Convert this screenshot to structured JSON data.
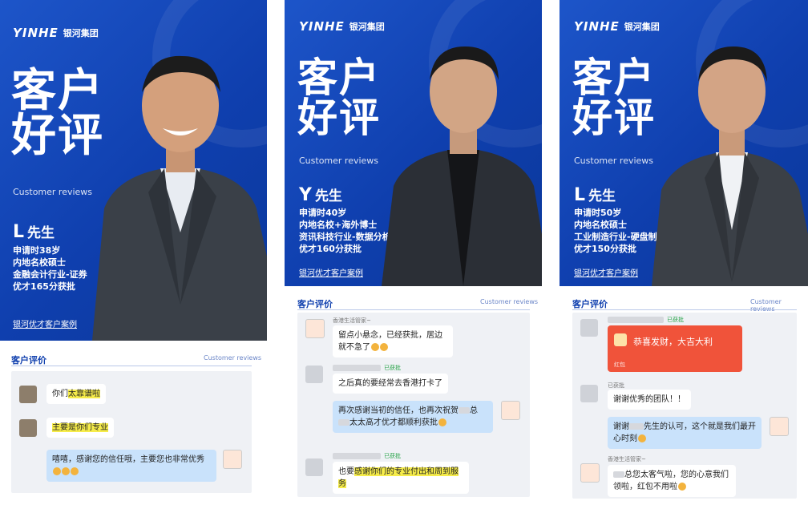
{
  "brand": {
    "mark": "YINHE",
    "name": "银河集团"
  },
  "cards": [
    {
      "title_line1": "客户",
      "title_line2": "好评",
      "subtitle": "Customer reviews",
      "initial": "L",
      "suffix": "先生",
      "facts": [
        "申请时38岁",
        "内地名校硕士",
        "金融会计行业-证券",
        "优才165分获批"
      ],
      "link": "银河优才客户案例",
      "section_title": "客户评价",
      "section_en": "Customer reviews",
      "messages": [
        {
          "pre": "你们",
          "hl": "太靠谱啦",
          "post": ""
        },
        {
          "pre": "",
          "hl": "主要是你们专业",
          "post": ""
        },
        {
          "text": "嘻嘻，感谢您的信任哦，主要您也非常优秀"
        }
      ]
    },
    {
      "title_line1": "客户",
      "title_line2": "好评",
      "subtitle": "Customer reviews",
      "initial": "Y",
      "suffix": "先生",
      "facts": [
        "申请时40岁",
        "内地名校+海外博士",
        "资讯科技行业-数据分析",
        "优才160分获批"
      ],
      "link": "银河优才客户案例",
      "section_title": "客户评价",
      "section_en": "Customer reviews",
      "meta1": "香港生活管家~",
      "msg1": "留点小悬念，已经获批，居边就不急了",
      "meta2": "已获批",
      "meta2_tag": "已获批",
      "msg2": "之后真的要经常去香港打卡了",
      "msg3_a": "再次感谢当初的信任，也再次祝贺",
      "msg3_b": "总",
      "msg3_c": "太太高才优才都顺利获批",
      "meta4_tag": "已获批",
      "msg4_pre": "也要",
      "msg4_hl": "感谢你们的专业付出和周到服务"
    },
    {
      "title_line1": "客户",
      "title_line2": "好评",
      "subtitle": "Customer reviews",
      "initial": "L",
      "suffix": "先生",
      "facts": [
        "申请时50岁",
        "内地名校硕士",
        "工业制造行业-硬盘制造",
        "优才150分获批"
      ],
      "link": "银河优才客户案例",
      "section_title": "客户评价",
      "section_en": "Customer reviews",
      "meta1": "已获批",
      "meta1_tag": "已获批",
      "redenv_text": "恭喜发财，大吉大利",
      "redenv_label": "红包",
      "meta2": "已获批",
      "msg2": "谢谢优秀的团队！！",
      "msg3_a": "谢谢",
      "msg3_b": "先生的认可，这个就是我们最开心时刻",
      "meta4": "香港生活管家~",
      "msg4_a": "总您太客气啦，您的心意我们领啦，红包不用啦"
    }
  ],
  "colors": {
    "brand_blue": "#0f3fae",
    "bubble_blue": "#c9e2fb",
    "highlight": "#f6ec4a",
    "red_packet": "#f0533a",
    "tag_green": "#2aa44a"
  }
}
